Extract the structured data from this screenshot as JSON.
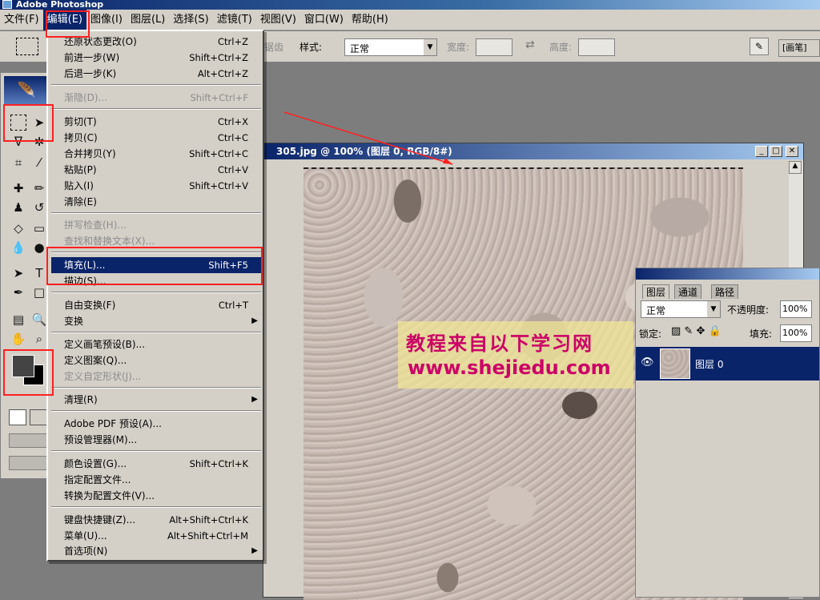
{
  "app": {
    "title": "Adobe Photoshop"
  },
  "menubar": [
    "文件(F)",
    "编辑(E)",
    "图像(I)",
    "图层(L)",
    "选择(S)",
    "滤镜(T)",
    "视图(V)",
    "窗口(W)",
    "帮助(H)"
  ],
  "options": {
    "antialias": "锯齿",
    "style_label": "样式:",
    "style_value": "正常",
    "width_label": "宽度:",
    "height_label": "高度:",
    "palette_label": "画笔"
  },
  "edit_menu": {
    "undo": {
      "label": "还原状态更改(O)",
      "shortcut": "Ctrl+Z"
    },
    "step_forward": {
      "label": "前进一步(W)",
      "shortcut": "Shift+Ctrl+Z"
    },
    "step_backward": {
      "label": "后退一步(K)",
      "shortcut": "Alt+Ctrl+Z"
    },
    "fade": {
      "label": "渐隐(D)...",
      "shortcut": "Shift+Ctrl+F"
    },
    "cut": {
      "label": "剪切(T)",
      "shortcut": "Ctrl+X"
    },
    "copy": {
      "label": "拷贝(C)",
      "shortcut": "Ctrl+C"
    },
    "copy_merged": {
      "label": "合并拷贝(Y)",
      "shortcut": "Shift+Ctrl+C"
    },
    "paste": {
      "label": "粘贴(P)",
      "shortcut": "Ctrl+V"
    },
    "paste_into": {
      "label": "贴入(I)",
      "shortcut": "Shift+Ctrl+V"
    },
    "clear": {
      "label": "清除(E)"
    },
    "check_spelling": {
      "label": "拼写检查(H)..."
    },
    "find_replace": {
      "label": "查找和替换文本(X)..."
    },
    "fill": {
      "label": "填充(L)...",
      "shortcut": "Shift+F5"
    },
    "stroke": {
      "label": "描边(S)..."
    },
    "free_transform": {
      "label": "自由变换(F)",
      "shortcut": "Ctrl+T"
    },
    "transform": {
      "label": "变换"
    },
    "define_brush": {
      "label": "定义画笔预设(B)..."
    },
    "define_pattern": {
      "label": "定义图案(Q)..."
    },
    "define_shape": {
      "label": "定义自定形状(J)..."
    },
    "purge": {
      "label": "清理(R)"
    },
    "pdf_presets": {
      "label": "Adobe PDF 预设(A)..."
    },
    "preset_manager": {
      "label": "预设管理器(M)..."
    },
    "color_settings": {
      "label": "颜色设置(G)...",
      "shortcut": "Shift+Ctrl+K"
    },
    "assign_profile": {
      "label": "指定配置文件..."
    },
    "convert_profile": {
      "label": "转换为配置文件(V)..."
    },
    "keyboard_shortcuts": {
      "label": "键盘快捷键(Z)...",
      "shortcut": "Alt+Shift+Ctrl+K"
    },
    "menus": {
      "label": "菜单(U)...",
      "shortcut": "Alt+Shift+Ctrl+M"
    },
    "preferences": {
      "label": "首选项(N)"
    }
  },
  "document": {
    "title": "305.jpg @ 100% (图层 0, RGB/8#)"
  },
  "watermark": {
    "line1": "教程来自以下学习网",
    "line2": "www.shejiedu.com"
  },
  "layers_panel": {
    "tabs": [
      "图层",
      "通道",
      "路径"
    ],
    "blend_mode": "正常",
    "opacity_label": "不透明度:",
    "opacity": "100%",
    "lock_label": "锁定:",
    "fill_label": "填充:",
    "fill": "100%",
    "layer_name": "图层 0"
  },
  "colors": {
    "highlight": "#0a246a",
    "annotation": "#ff2020"
  }
}
